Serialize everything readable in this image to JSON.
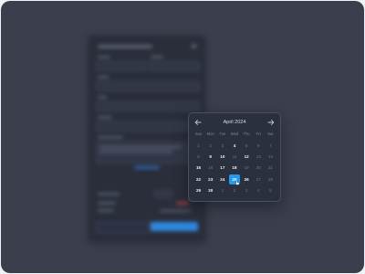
{
  "calendar": {
    "month_label": "April 2024",
    "prev_icon": "arrow-left-icon",
    "next_icon": "arrow-right-icon",
    "weekdays": [
      "Sun",
      "Mon",
      "Tue",
      "Wed",
      "Thu",
      "Fri",
      "Sat"
    ],
    "selected_day": "25",
    "accent_color": "#1f9cf0",
    "weeks": [
      [
        {
          "d": "1",
          "b": false
        },
        {
          "d": "2",
          "b": false
        },
        {
          "d": "3",
          "b": false
        },
        {
          "d": "4",
          "b": true
        },
        {
          "d": "5",
          "b": false
        },
        {
          "d": "6",
          "b": false
        },
        {
          "d": "7",
          "b": false
        }
      ],
      [
        {
          "d": "8",
          "b": false
        },
        {
          "d": "9",
          "b": true
        },
        {
          "d": "10",
          "b": true
        },
        {
          "d": "11",
          "b": false
        },
        {
          "d": "12",
          "b": true
        },
        {
          "d": "13",
          "b": false
        },
        {
          "d": "14",
          "b": false
        }
      ],
      [
        {
          "d": "15",
          "b": true
        },
        {
          "d": "16",
          "b": false
        },
        {
          "d": "17",
          "b": true
        },
        {
          "d": "18",
          "b": true
        },
        {
          "d": "19",
          "b": false
        },
        {
          "d": "20",
          "b": false
        },
        {
          "d": "21",
          "b": false
        }
      ],
      [
        {
          "d": "22",
          "b": true
        },
        {
          "d": "23",
          "b": true
        },
        {
          "d": "24",
          "b": true
        },
        {
          "d": "25",
          "b": true
        },
        {
          "d": "26",
          "b": true
        },
        {
          "d": "27",
          "b": false
        },
        {
          "d": "28",
          "b": false
        }
      ],
      [
        {
          "d": "29",
          "b": true
        },
        {
          "d": "30",
          "b": true
        },
        {
          "d": "1",
          "b": false
        },
        {
          "d": "2",
          "b": false
        },
        {
          "d": "3",
          "b": false
        },
        {
          "d": "4",
          "b": false
        },
        {
          "d": "5",
          "b": false
        }
      ]
    ]
  }
}
